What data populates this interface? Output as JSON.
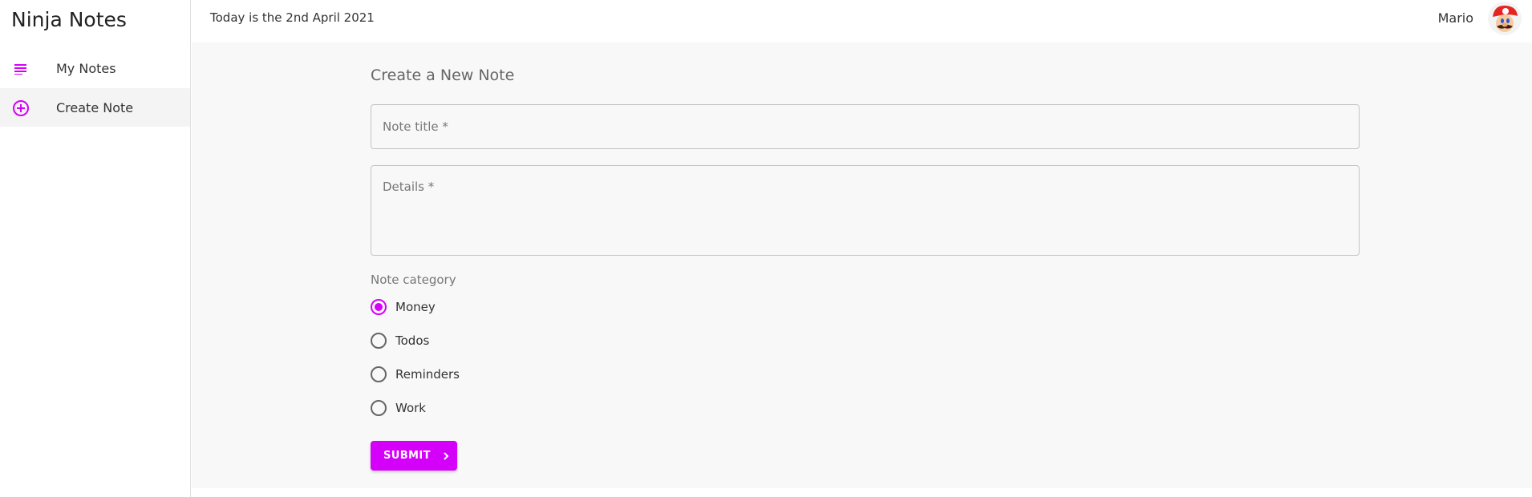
{
  "brand": {
    "title": "Ninja Notes"
  },
  "sidebar": {
    "items": [
      {
        "label": "My Notes",
        "icon": "subject-icon",
        "active": false
      },
      {
        "label": "Create Note",
        "icon": "add-circle-icon",
        "active": true
      }
    ]
  },
  "header": {
    "date_text": "Today is the 2nd April 2021",
    "username": "Mario",
    "avatar_icon": "mario-avatar"
  },
  "form": {
    "title": "Create a New Note",
    "note_title_placeholder": "Note title *",
    "details_placeholder": "Details *",
    "category_label": "Note category",
    "categories": [
      {
        "label": "Money",
        "selected": true
      },
      {
        "label": "Todos",
        "selected": false
      },
      {
        "label": "Reminders",
        "selected": false
      },
      {
        "label": "Work",
        "selected": false
      }
    ],
    "submit_label": "SUBMIT"
  },
  "colors": {
    "accent": "#d500f9",
    "background": "#f8f8f8",
    "sidebar_active": "#f4f4f4"
  }
}
